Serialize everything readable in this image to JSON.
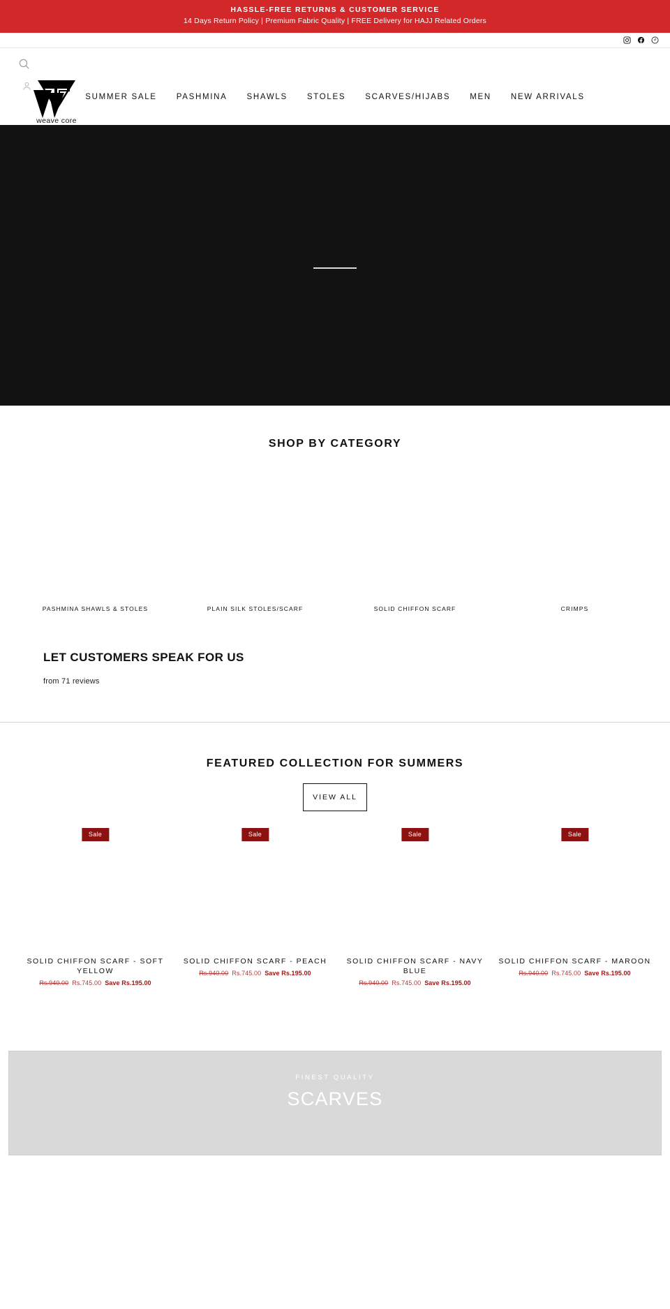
{
  "announcement": {
    "line1": "HASSLE-FREE RETURNS & CUSTOMER SERVICE",
    "line2": "14 Days Return Policy | Premium Fabric Quality | FREE Delivery for HAJJ Related Orders",
    "background": "#d2282a"
  },
  "social": [
    {
      "name": "instagram-icon",
      "label": "Instagram"
    },
    {
      "name": "facebook-icon",
      "label": "Facebook"
    },
    {
      "name": "pinterest-icon",
      "label": "Pinterest"
    }
  ],
  "header": {
    "search_icon": "search-icon",
    "account_icon": "account-icon",
    "logo_text": "weave core",
    "nav": [
      {
        "label": "SUMMER SALE"
      },
      {
        "label": "PASHMINA"
      },
      {
        "label": "SHAWLS"
      },
      {
        "label": "STOLES"
      },
      {
        "label": "SCARVES/HIJABS"
      },
      {
        "label": "MEN"
      },
      {
        "label": "NEW ARRIVALS"
      }
    ]
  },
  "hero": {
    "background": "#121212"
  },
  "categories": {
    "title": "SHOP BY CATEGORY",
    "items": [
      {
        "label": "PASHMINA SHAWLS & STOLES"
      },
      {
        "label": "PLAIN SILK STOLES/SCARF"
      },
      {
        "label": "SOLID CHIFFON SCARF"
      },
      {
        "label": "CRIMPS"
      }
    ]
  },
  "reviews": {
    "title": "LET CUSTOMERS SPEAK FOR US",
    "subtitle": "from 71 reviews"
  },
  "featured": {
    "title": "FEATURED COLLECTION FOR SUMMERS",
    "view_all": "VIEW ALL",
    "sale_badge": "Sale",
    "products": [
      {
        "title": "SOLID CHIFFON SCARF - SOFT YELLOW",
        "price_was": "Rs.940.00",
        "price_now": "Rs.745.00",
        "price_save": "Save Rs.195.00",
        "badge": "Sale"
      },
      {
        "title": "SOLID CHIFFON SCARF - PEACH",
        "price_was": "Rs.940.00",
        "price_now": "Rs.745.00",
        "price_save": "Save Rs.195.00",
        "badge": "Sale"
      },
      {
        "title": "SOLID CHIFFON SCARF - NAVY BLUE",
        "price_was": "Rs.940.00",
        "price_now": "Rs.745.00",
        "price_save": "Save Rs.195.00",
        "badge": "Sale"
      },
      {
        "title": "SOLID CHIFFON SCARF - MAROON",
        "price_was": "Rs.940.00",
        "price_now": "Rs.745.00",
        "price_save": "Save Rs.195.00",
        "badge": "Sale"
      }
    ]
  },
  "bottom_banner": {
    "kicker": "FINEST QUALITY",
    "heading": "SCARVES"
  }
}
